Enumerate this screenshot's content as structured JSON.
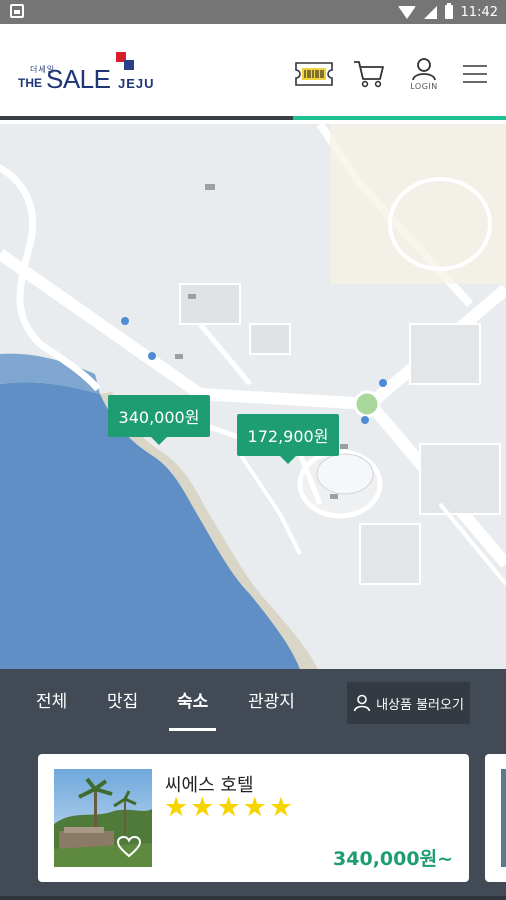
{
  "status_bar": {
    "time": "11:42"
  },
  "header": {
    "logo": {
      "korean": "더세일",
      "the": "THE",
      "sale": "SALE",
      "jeju": "JEJU"
    },
    "login_label": "LOGIN",
    "progress_fraction": 0.42,
    "colors": {
      "brand_navy": "#1f3576",
      "brand_red": "#d81e2b",
      "accent_green": "#1fbf94"
    }
  },
  "map": {
    "price_pins": [
      {
        "label": "340,000원"
      },
      {
        "label": "172,900원"
      }
    ]
  },
  "tabs": [
    {
      "label": "전체",
      "active": false
    },
    {
      "label": "맛집",
      "active": false
    },
    {
      "label": "숙소",
      "active": true
    },
    {
      "label": "관광지",
      "active": false
    }
  ],
  "mylist_button": {
    "label": "내상품 불러오기",
    "icon": "person-icon"
  },
  "listing": {
    "title": "씨에스 호텔",
    "rating": 5,
    "stars": "★★★★★",
    "price": "340,000원~",
    "price_color": "#1f9d72",
    "star_color": "#f5d400"
  }
}
